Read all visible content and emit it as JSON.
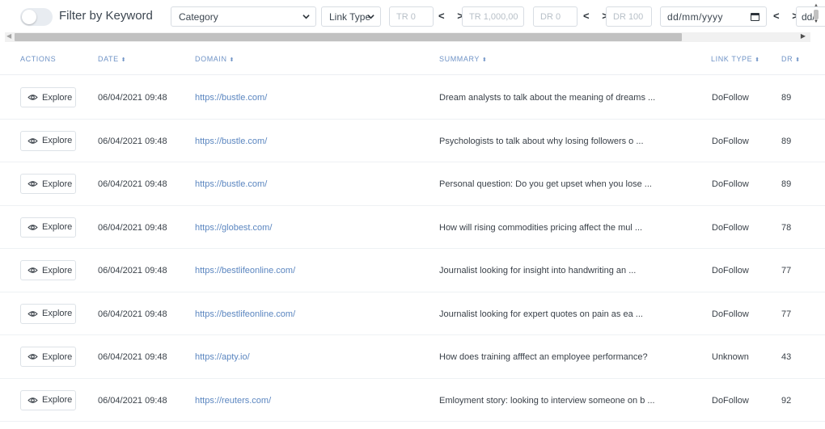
{
  "filters": {
    "keyword_toggle_label": "Filter by Keyword",
    "category_value": "Category",
    "link_type_value": "Link Type",
    "tr_min_placeholder": "TR 0",
    "tr_max_placeholder": "TR 1,000,00",
    "dr_min_placeholder": "DR 0",
    "dr_max_placeholder": "DR 100",
    "range_arrows": "< >",
    "date_placeholder": "dd/mm/yyyy",
    "date_end_placeholder": "dd/"
  },
  "table": {
    "columns": {
      "actions": "ACTIONS",
      "date": "DATE",
      "domain": "DOMAIN",
      "summary": "SUMMARY",
      "link_type": "LINK TYPE",
      "dr": "DR"
    },
    "explore_label": "Explore",
    "rows": [
      {
        "date": "06/04/2021 09:48",
        "domain": "https://bustle.com/",
        "summary": "Dream analysts to talk about the meaning of dreams ...",
        "link_type": "DoFollow",
        "dr": "89"
      },
      {
        "date": "06/04/2021 09:48",
        "domain": "https://bustle.com/",
        "summary": "Psychologists to talk about why losing followers o ...",
        "link_type": "DoFollow",
        "dr": "89"
      },
      {
        "date": "06/04/2021 09:48",
        "domain": "https://bustle.com/",
        "summary": "Personal question: Do you get upset when you lose ...",
        "link_type": "DoFollow",
        "dr": "89"
      },
      {
        "date": "06/04/2021 09:48",
        "domain": "https://globest.com/",
        "summary": "How will rising commodities pricing affect the mul ...",
        "link_type": "DoFollow",
        "dr": "78"
      },
      {
        "date": "06/04/2021 09:48",
        "domain": "https://bestlifeonline.com/",
        "summary": "Journalist looking for insight into handwriting an ...",
        "link_type": "DoFollow",
        "dr": "77"
      },
      {
        "date": "06/04/2021 09:48",
        "domain": "https://bestlifeonline.com/",
        "summary": "Journalist looking for expert quotes on pain as ea ...",
        "link_type": "DoFollow",
        "dr": "77"
      },
      {
        "date": "06/04/2021 09:48",
        "domain": "https://apty.io/",
        "summary": "How does training afffect an employee performance?",
        "link_type": "Unknown",
        "dr": "43"
      },
      {
        "date": "06/04/2021 09:48",
        "domain": "https://reuters.com/",
        "summary": "Emloyment story: looking to interview someone on b ...",
        "link_type": "DoFollow",
        "dr": "92"
      }
    ]
  },
  "colors": {
    "link": "#5b86c0",
    "header_text": "#6f93c6",
    "toggle_off": "#e8ecf1"
  }
}
